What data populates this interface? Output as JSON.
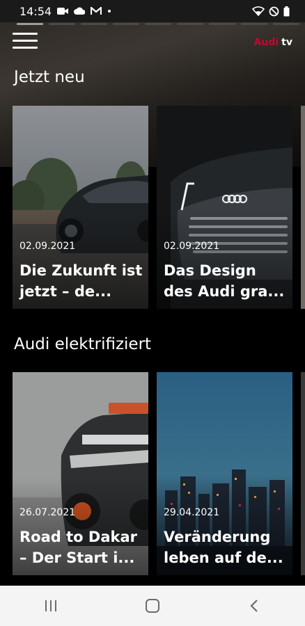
{
  "status_bar": {
    "time": "14:54",
    "icons_left": [
      "video-camera-icon",
      "cloud-icon",
      "gmail-icon",
      "dot-icon"
    ],
    "icons_right": [
      "wifi-icon",
      "do-not-disturb-icon",
      "battery-icon"
    ]
  },
  "header": {
    "logo_brand": "Audi",
    "logo_suffix": "tv",
    "menu_icon": "hamburger-menu-icon"
  },
  "story_progress": {
    "total": 9,
    "active_index": 0
  },
  "colors": {
    "brand_red": "#bb0a30",
    "background": "#000000",
    "nav_bar": "#f4f4f4"
  },
  "sections": [
    {
      "title": "Jetzt neu",
      "cards": [
        {
          "date": "02.09.2021",
          "title": "Die Zukunft ist jetzt – de..."
        },
        {
          "date": "02.09.2021",
          "title": "Das Design des Audi gra..."
        }
      ]
    },
    {
      "title": "Audi elektrifiziert",
      "cards": [
        {
          "date": "26.07.2021",
          "title": "Road to Dakar – Der Start i..."
        },
        {
          "date": "29.04.2021",
          "title": "Veränderung leben auf de..."
        }
      ]
    }
  ],
  "nav_bar": {
    "buttons": [
      "recent-apps-icon",
      "home-icon",
      "back-icon"
    ]
  }
}
